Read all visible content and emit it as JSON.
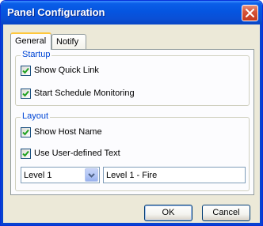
{
  "window": {
    "title": "Panel Configuration"
  },
  "tabs": [
    {
      "label": "General",
      "selected": true
    },
    {
      "label": "Notify",
      "selected": false
    }
  ],
  "startup": {
    "label": "Startup",
    "show_quick_link": {
      "label": "Show Quick Link",
      "checked": true
    },
    "schedule_monitoring": {
      "label": "Start Schedule Monitoring",
      "checked": true
    }
  },
  "layout": {
    "label": "Layout",
    "show_host_name": {
      "label": "Show Host Name",
      "checked": true
    },
    "user_defined_text": {
      "label": "Use User-defined Text",
      "checked": true
    },
    "level_select": {
      "value": "Level 1"
    },
    "level_text": {
      "value": "Level 1 - Fire"
    }
  },
  "buttons": {
    "ok": "OK",
    "cancel": "Cancel"
  },
  "icons": {
    "close": "close-icon",
    "check": "check-icon",
    "dropdown": "chevron-down-icon"
  },
  "colors": {
    "title_bar": "#0555e0",
    "group_label": "#0046d5",
    "close_button": "#d6553a",
    "active_tab_accent": "#ffc83c"
  }
}
